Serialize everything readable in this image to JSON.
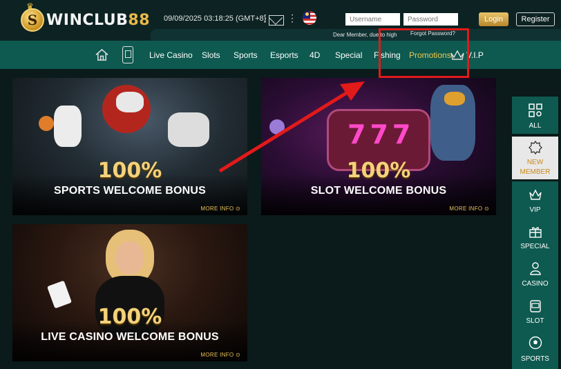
{
  "brand": {
    "logo_letter": "S",
    "name_main": "WINCLUB",
    "name_num": "88"
  },
  "header": {
    "datetime": "09/09/2025 03:18:25 (GMT+8)",
    "username_placeholder": "Username",
    "password_placeholder": "Password",
    "login_label": "Login",
    "register_label": "Register",
    "notice": "Dear Member, due to high",
    "forgot_password": "Forgot Password?"
  },
  "nav": {
    "items": [
      "Live Casino",
      "Slots",
      "Sports",
      "Esports",
      "4D",
      "Special",
      "Fishing",
      "Promotions",
      "V.I.P"
    ],
    "active": "Promotions"
  },
  "promotions": [
    {
      "percent": "100%",
      "title": "SPORTS WELCOME BONUS",
      "more": "MORE INFO"
    },
    {
      "percent": "100%",
      "title": "SLOT WELCOME BONUS",
      "more": "MORE INFO"
    },
    {
      "percent": "100%",
      "title": "LIVE CASINO WELCOME BONUS",
      "more": "MORE INFO"
    }
  ],
  "side_menu": [
    "ALL",
    "NEW",
    "MEMBER",
    "VIP",
    "SPECIAL",
    "CASINO",
    "SLOT",
    "SPORTS"
  ],
  "colors": {
    "accent_gold": "#f1c84c",
    "nav_green": "#0e5a50",
    "annotation_red": "#e21a1a"
  }
}
